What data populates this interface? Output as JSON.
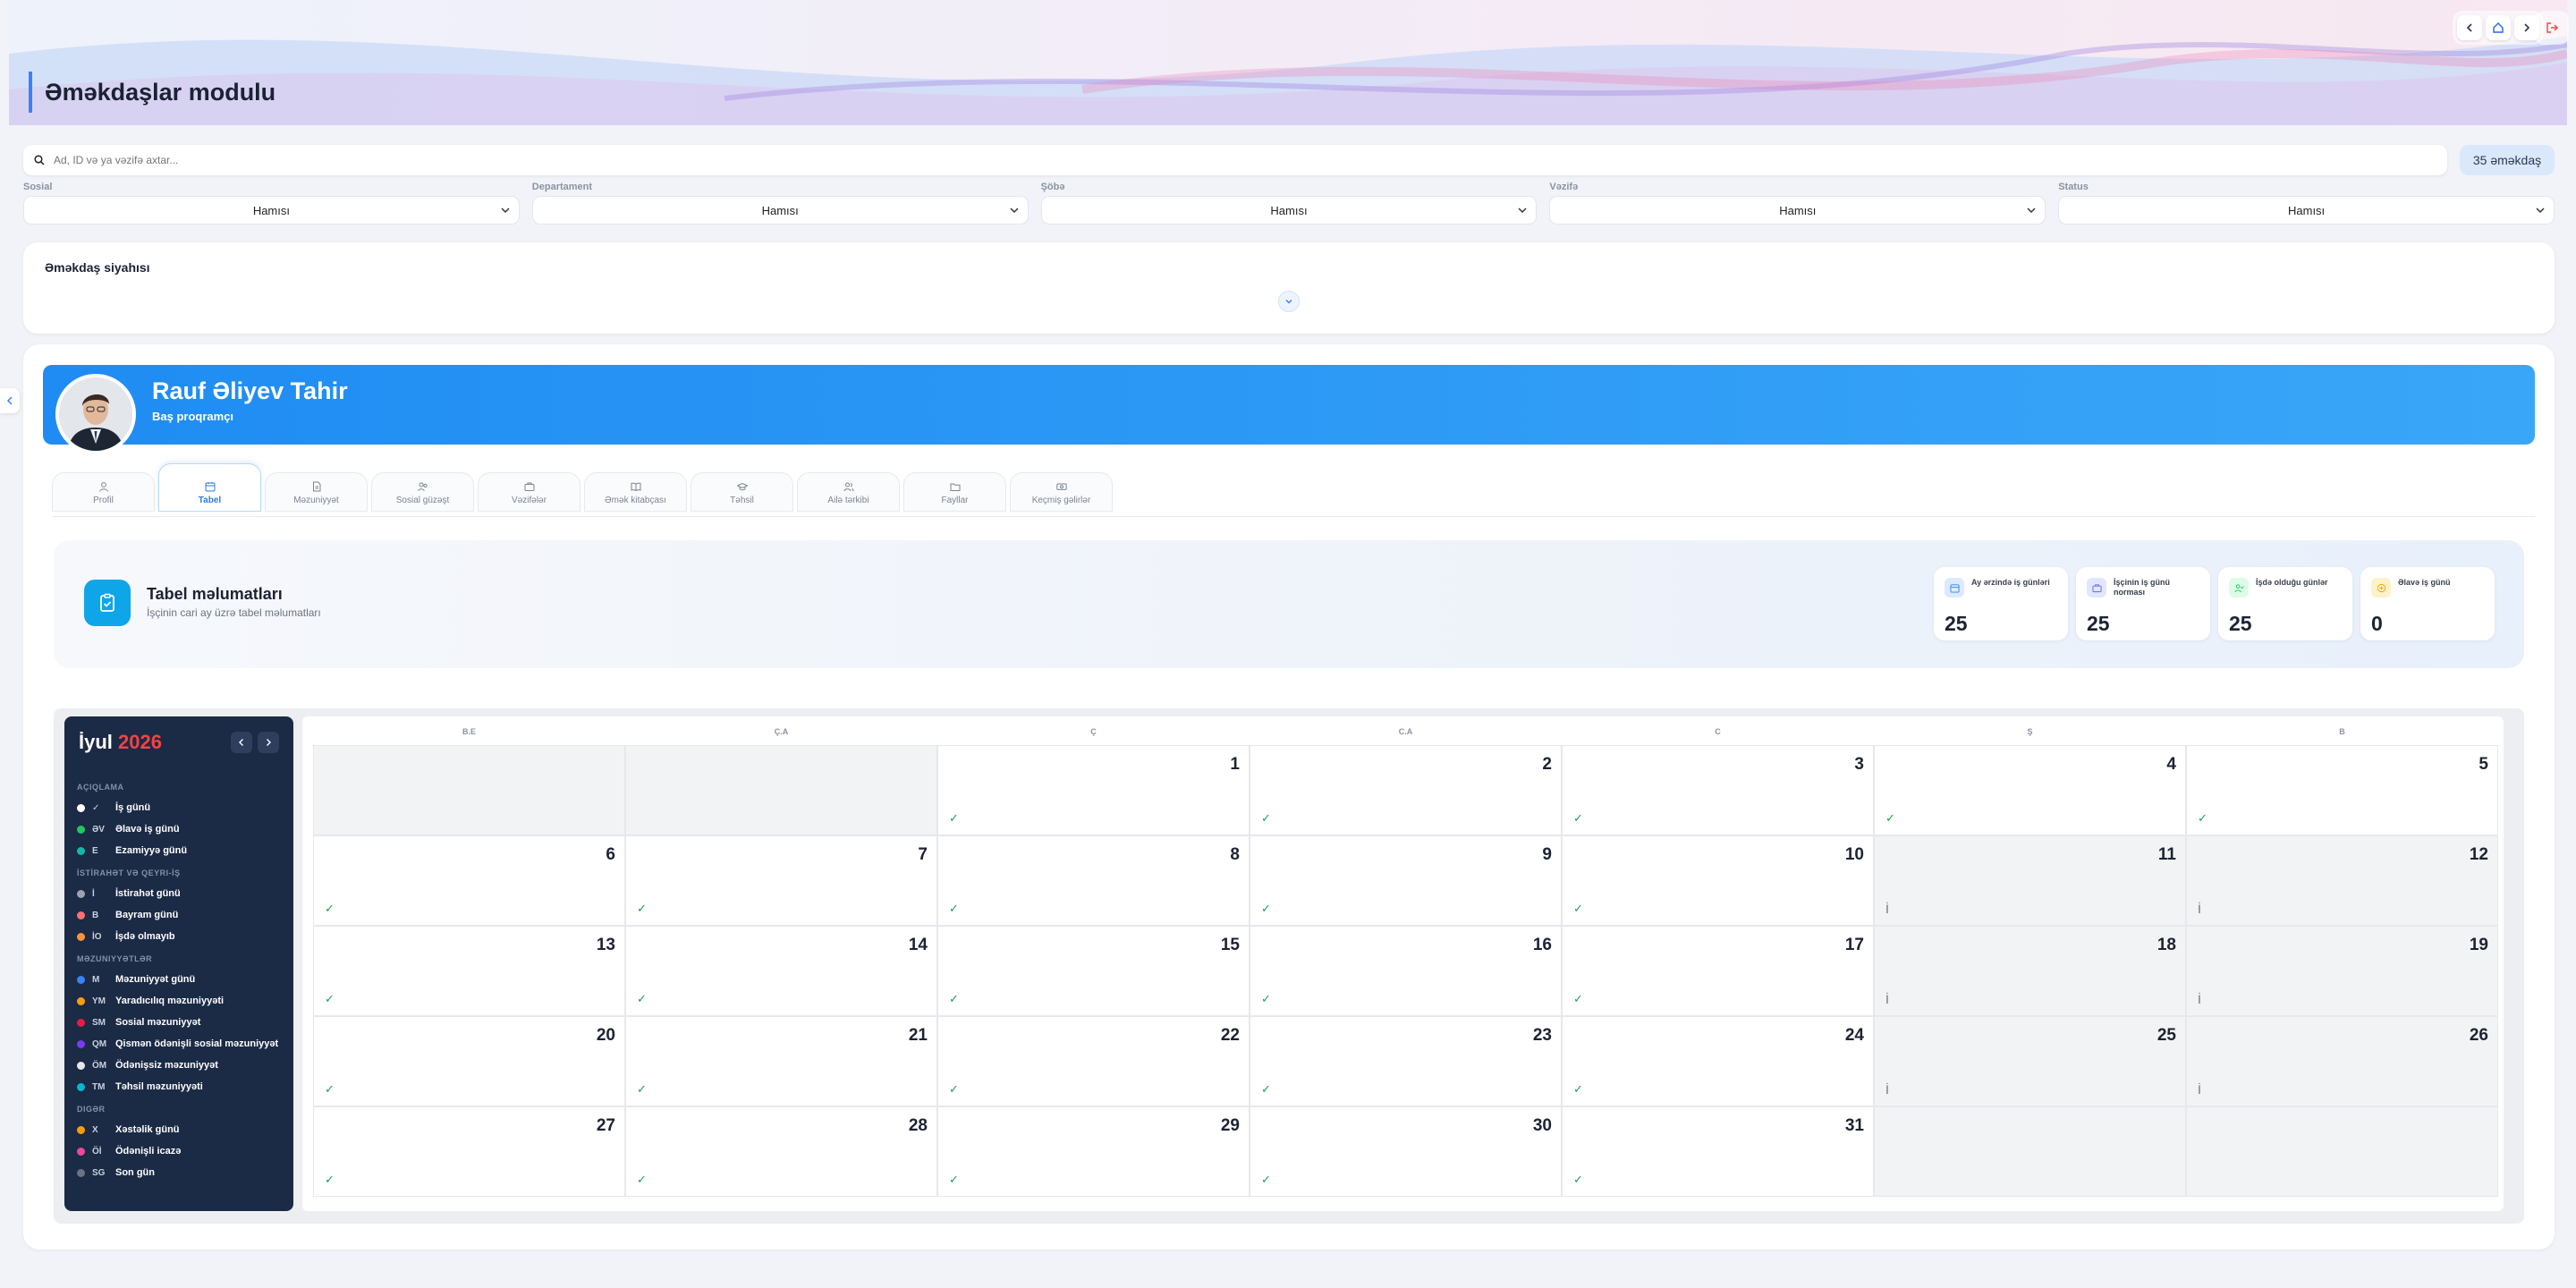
{
  "header": {
    "title": "Əməkdaşlar modulu"
  },
  "search": {
    "placeholder": "Ad, ID və ya vəzifə axtar...",
    "count": "35 əməkdaş"
  },
  "filters": [
    {
      "label": "Sosial",
      "value": "Hamısı"
    },
    {
      "label": "Departament",
      "value": "Hamısı"
    },
    {
      "label": "Şöbə",
      "value": "Hamısı"
    },
    {
      "label": "Vəzifə",
      "value": "Hamısı"
    },
    {
      "label": "Status",
      "value": "Hamısı"
    }
  ],
  "employee_list": {
    "title": "Əməkdaş siyahısı"
  },
  "profile": {
    "name": "Rauf Əliyev Tahir",
    "role": "Baş proqramçı"
  },
  "tabs": [
    {
      "label": "Profil",
      "icon": "user-icon"
    },
    {
      "label": "Tabel",
      "icon": "calendar-icon",
      "active": true
    },
    {
      "label": "Məzuniyyət",
      "icon": "document-icon"
    },
    {
      "label": "Sosial güzəşt",
      "icon": "people-icon"
    },
    {
      "label": "Vəzifələr",
      "icon": "briefcase-icon"
    },
    {
      "label": "Əmək kitabçası",
      "icon": "book-icon"
    },
    {
      "label": "Təhsil",
      "icon": "graduation-cap-icon"
    },
    {
      "label": "Ailə tərkibi",
      "icon": "family-icon"
    },
    {
      "label": "Fayllar",
      "icon": "folder-icon"
    },
    {
      "label": "Keçmiş gəlirlər",
      "icon": "money-icon"
    }
  ],
  "tabel": {
    "title": "Tabel məlumatları",
    "subtitle": "İşçinin cari ay üzrə tabel məlumatları",
    "stats": [
      {
        "label": "Ay ərzində iş günləri",
        "value": "25",
        "color": "#3b82f6"
      },
      {
        "label": "İşçinin iş günü norması",
        "value": "25",
        "color": "#6366f1"
      },
      {
        "label": "İşdə olduğu günlər",
        "value": "25",
        "color": "#22c55e"
      },
      {
        "label": "Əlavə iş günü",
        "value": "0",
        "color": "#f59e0b"
      }
    ]
  },
  "calendar": {
    "month": "İyul",
    "year": "2026",
    "weekdays": [
      "B.E",
      "Ç.A",
      "Ç",
      "C.A",
      "C",
      "Ş",
      "B"
    ],
    "days": [
      {
        "d": "1",
        "t": "work"
      },
      {
        "d": "2",
        "t": "work"
      },
      {
        "d": "3",
        "t": "work"
      },
      {
        "d": "4",
        "t": "work"
      },
      {
        "d": "5",
        "t": "work"
      },
      {
        "d": "6",
        "t": "work"
      },
      {
        "d": "7",
        "t": "work"
      },
      {
        "d": "8",
        "t": "work"
      },
      {
        "d": "9",
        "t": "work"
      },
      {
        "d": "10",
        "t": "work"
      },
      {
        "d": "11",
        "t": "rest"
      },
      {
        "d": "12",
        "t": "rest"
      },
      {
        "d": "13",
        "t": "work"
      },
      {
        "d": "14",
        "t": "work"
      },
      {
        "d": "15",
        "t": "work"
      },
      {
        "d": "16",
        "t": "work"
      },
      {
        "d": "17",
        "t": "work"
      },
      {
        "d": "18",
        "t": "rest"
      },
      {
        "d": "19",
        "t": "rest"
      },
      {
        "d": "20",
        "t": "work"
      },
      {
        "d": "21",
        "t": "work"
      },
      {
        "d": "22",
        "t": "work"
      },
      {
        "d": "23",
        "t": "work"
      },
      {
        "d": "24",
        "t": "work"
      },
      {
        "d": "25",
        "t": "rest"
      },
      {
        "d": "26",
        "t": "rest"
      },
      {
        "d": "27",
        "t": "work"
      },
      {
        "d": "28",
        "t": "work"
      },
      {
        "d": "29",
        "t": "work"
      },
      {
        "d": "30",
        "t": "work"
      },
      {
        "d": "31",
        "t": "work"
      }
    ],
    "first_weekday_index": 2,
    "marks": {
      "work": "✓",
      "rest": "İ"
    }
  },
  "legend": {
    "sections": [
      {
        "title": "AÇIQLAMA",
        "items": [
          {
            "code": "✓",
            "label": "İş günü",
            "color": "#ffffff"
          },
          {
            "code": "ƏV",
            "label": "Əlavə iş günü",
            "color": "#22c55e"
          },
          {
            "code": "E",
            "label": "Ezamiyyə günü",
            "color": "#14b8a6"
          }
        ]
      },
      {
        "title": "İSTİRAHƏT VƏ QEYRI-İŞ",
        "items": [
          {
            "code": "İ",
            "label": "İstirahət günü",
            "color": "#9ca3af"
          },
          {
            "code": "B",
            "label": "Bayram günü",
            "color": "#f87171"
          },
          {
            "code": "İO",
            "label": "İşdə olmayıb",
            "color": "#fb923c"
          }
        ]
      },
      {
        "title": "MƏZUNIYYƏTLƏR",
        "items": [
          {
            "code": "M",
            "label": "Məzuniyyət günü",
            "color": "#3b82f6"
          },
          {
            "code": "YM",
            "label": "Yaradıcılıq məzuniyyəti",
            "color": "#f59e0b"
          },
          {
            "code": "SM",
            "label": "Sosial məzuniyyət",
            "color": "#e11d48"
          },
          {
            "code": "QM",
            "label": "Qismən ödənişli sosial məzuniyyət",
            "color": "#7c3aed"
          },
          {
            "code": "ÖM",
            "label": "Ödənişsiz məzuniyyət",
            "color": "#e5e7eb"
          },
          {
            "code": "TM",
            "label": "Təhsil məzuniyyəti",
            "color": "#06b6d4"
          }
        ]
      },
      {
        "title": "DIGƏR",
        "items": [
          {
            "code": "X",
            "label": "Xəstəlik günü",
            "color": "#f59e0b"
          },
          {
            "code": "Öİ",
            "label": "Ödənişli icazə",
            "color": "#ec4899"
          },
          {
            "code": "SG",
            "label": "Son gün",
            "color": "#6b7280"
          }
        ]
      }
    ]
  }
}
